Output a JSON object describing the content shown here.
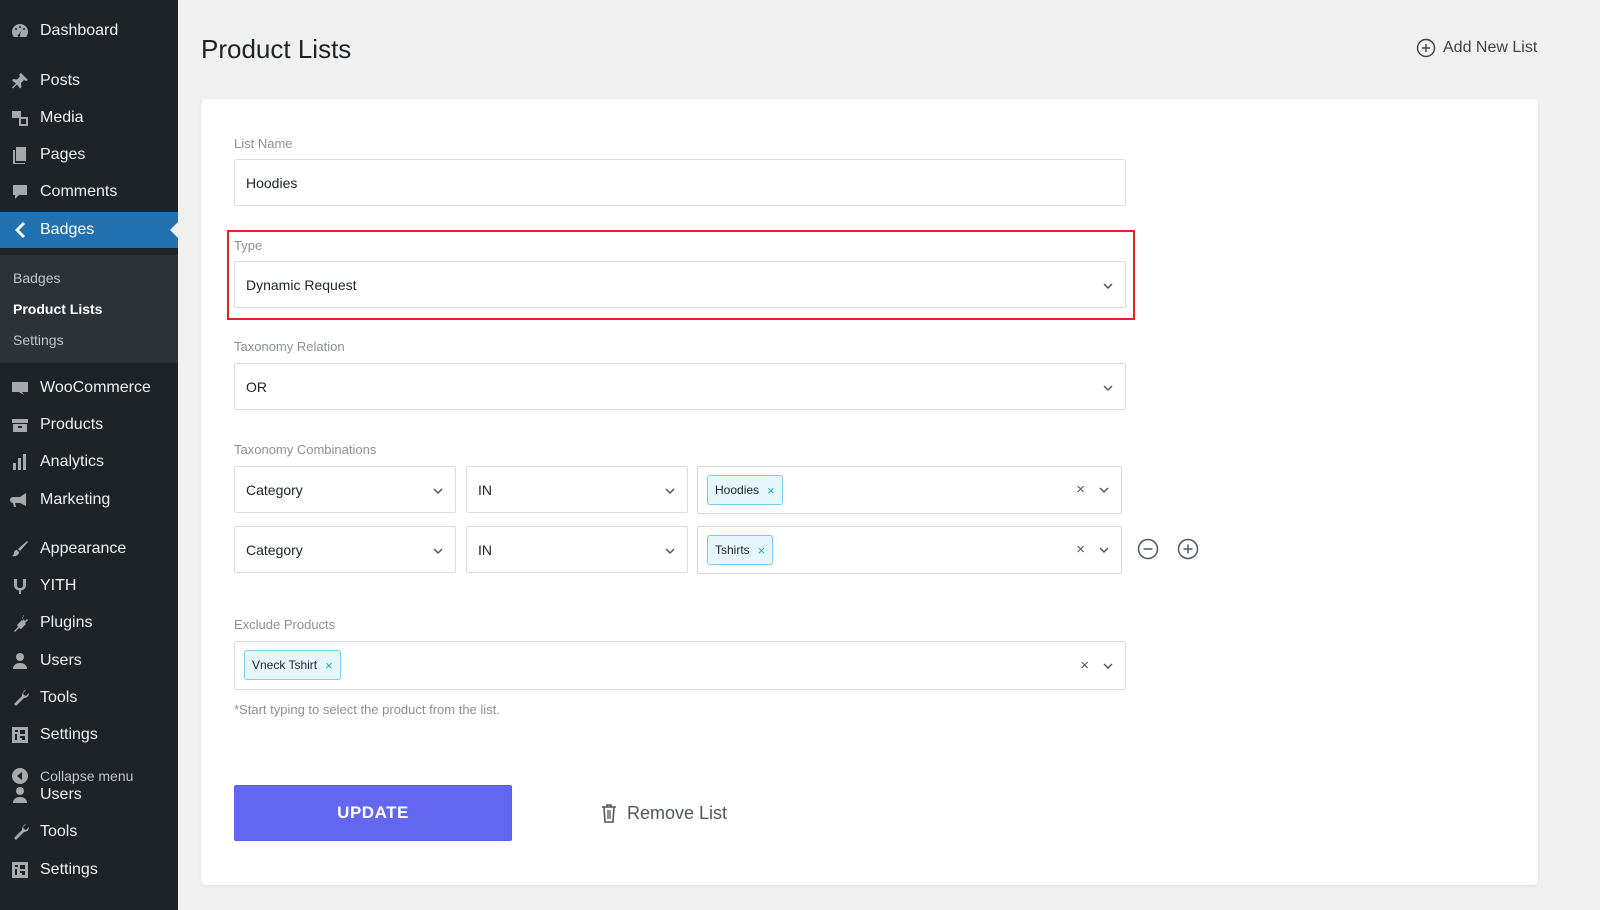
{
  "sidebar": {
    "items": [
      {
        "label": "Dashboard",
        "icon": "dashboard-icon"
      },
      {
        "label": "Posts",
        "icon": "pin-icon"
      },
      {
        "label": "Media",
        "icon": "media-icon"
      },
      {
        "label": "Pages",
        "icon": "pages-icon"
      },
      {
        "label": "Comments",
        "icon": "comment-icon"
      },
      {
        "label": "Badges",
        "icon": "badge-icon"
      },
      {
        "label": "WooCommerce",
        "icon": "woo-icon"
      },
      {
        "label": "Products",
        "icon": "products-icon"
      },
      {
        "label": "Analytics",
        "icon": "analytics-icon"
      },
      {
        "label": "Marketing",
        "icon": "megaphone-icon"
      },
      {
        "label": "Appearance",
        "icon": "brush-icon"
      },
      {
        "label": "YITH",
        "icon": "yith-icon"
      },
      {
        "label": "Plugins",
        "icon": "plugin-icon"
      },
      {
        "label": "Users",
        "icon": "user-icon"
      },
      {
        "label": "Tools",
        "icon": "wrench-icon"
      },
      {
        "label": "Settings",
        "icon": "settings-icon"
      },
      {
        "label": "Collapse menu",
        "icon": "collapse-icon"
      },
      {
        "label": "Users",
        "icon": "user-icon"
      },
      {
        "label": "Tools",
        "icon": "wrench-icon"
      },
      {
        "label": "Settings",
        "icon": "settings-icon"
      }
    ],
    "submenu": [
      {
        "label": "Badges"
      },
      {
        "label": "Product Lists"
      },
      {
        "label": "Settings"
      }
    ]
  },
  "header": {
    "title": "Product Lists",
    "add_new_label": "Add New List"
  },
  "form": {
    "list_name": {
      "label": "List Name",
      "value": "Hoodies"
    },
    "type": {
      "label": "Type",
      "value": "Dynamic Request"
    },
    "taxonomy_relation": {
      "label": "Taxonomy Relation",
      "value": "OR"
    },
    "taxonomy_combinations": {
      "label": "Taxonomy Combinations",
      "rows": [
        {
          "taxonomy": "Category",
          "operator": "IN",
          "terms": [
            "Hoodies"
          ]
        },
        {
          "taxonomy": "Category",
          "operator": "IN",
          "terms": [
            "Tshirts"
          ]
        }
      ]
    },
    "exclude_products": {
      "label": "Exclude Products",
      "values": [
        "Vneck Tshirt"
      ],
      "hint": "*Start typing to select the product from the list."
    },
    "tag_remove_glyph": "×",
    "clear_glyph": "×",
    "update_label": "UPDATE",
    "remove_label": "Remove List"
  },
  "colors": {
    "sidebar_bg": "#1d2327",
    "active_menu": "#2271b1",
    "update_button": "#6366f1",
    "highlight_border": "#e02424",
    "tag_bg": "#e6f7fb"
  }
}
